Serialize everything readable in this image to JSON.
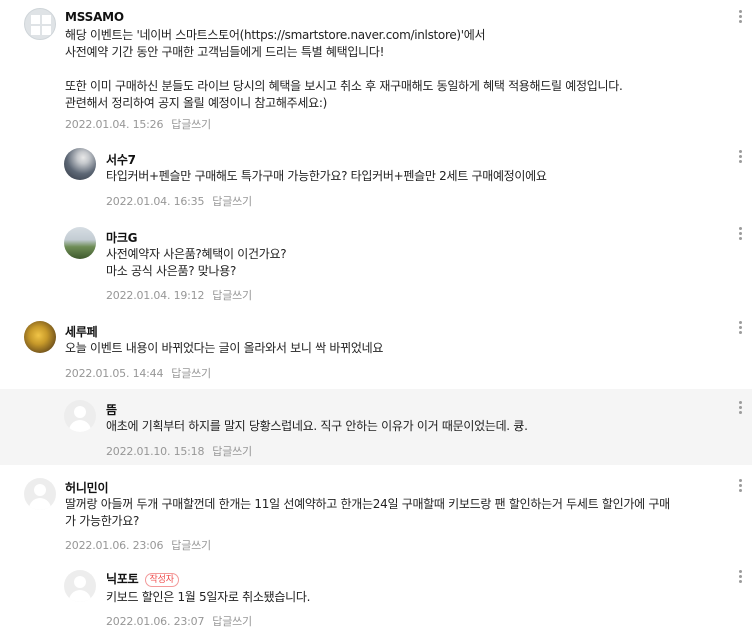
{
  "reply_label": "답글쓰기",
  "comments": [
    {
      "author": "MSSAMO",
      "lines": [
        "해당 이벤트는 '네이버 스마트스토어(https://smartstore.naver.com/inlstore)'에서",
        "사전예약 기간 동안 구매한 고객님들에게 드리는 특별 혜택입니다!",
        "",
        "또한 이미 구매하신 분들도 라이브 당시의 혜택을 보시고 취소 후 재구매해도 동일하게 혜택 적용해드릴 예정입니다.",
        "관련해서 정리하여 공지 올릴 예정이니 참고해주세요:)"
      ],
      "date": "2022.01.04. 15:26"
    },
    {
      "author": "서수7",
      "lines": [
        "타입커버+펜슬만 구매해도 특가구매 가능한가요? 타입커버+펜슬만 2세트 구매예정이에요"
      ],
      "date": "2022.01.04. 16:35"
    },
    {
      "author": "마크G",
      "lines": [
        "사전예약자 사은품?혜택이 이건가요?",
        "마소 공식 사은품? 맞나용?"
      ],
      "date": "2022.01.04. 19:12"
    },
    {
      "author": "세루페",
      "lines": [
        "오늘 이벤트 내용이 바뀌었다는 글이 올라와서 보니 싹 바뀌었네요"
      ],
      "date": "2022.01.05. 14:44"
    },
    {
      "author": "뜸",
      "lines": [
        "애초에 기획부터 하지를 말지 당황스럽네요. 직구 안하는 이유가 이거 때문이었는데. 큥."
      ],
      "date": "2022.01.10. 15:18"
    },
    {
      "author": "허니민이",
      "lines": [
        "딸꺼랑 아들꺼 두개 구매할껀데 한개는 11일 선예약하고 한개는24일 구매할때 키보드랑 팬 할인하는거 두세트 할인가에 구매",
        "가 가능한가요?"
      ],
      "date": "2022.01.06. 23:06"
    },
    {
      "author": "닉포토",
      "badge": "작성자",
      "lines": [
        "키보드 할인은 1월 5일자로 취소됐습니다."
      ],
      "date": "2022.01.06. 23:07"
    }
  ]
}
